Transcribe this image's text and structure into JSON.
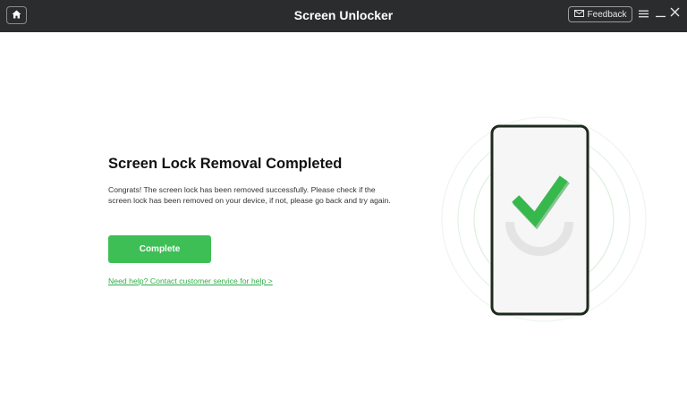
{
  "window": {
    "title": "Screen Unlocker",
    "feedback_label": "Feedback",
    "icons": {
      "home": "home-icon",
      "feedback": "mail-icon",
      "menu": "hamburger-menu-icon",
      "minimize": "minimize-icon",
      "close": "close-icon"
    }
  },
  "main": {
    "heading": "Screen Lock Removal Completed",
    "description": "Congrats! The screen lock has been removed successfully. Please check if the screen lock has been removed on your device, if not, please go back and try again.",
    "complete_button": "Complete",
    "help_link": "Need help? Contact customer service for help >"
  },
  "illustration": {
    "icon": "phone-with-checkmark-illustration",
    "status": "success"
  },
  "colors": {
    "titlebar": "#2b2c2e",
    "accent_green": "#3dbf55",
    "link_green": "#2fae4a",
    "phone_outline": "#1e2a1e"
  }
}
